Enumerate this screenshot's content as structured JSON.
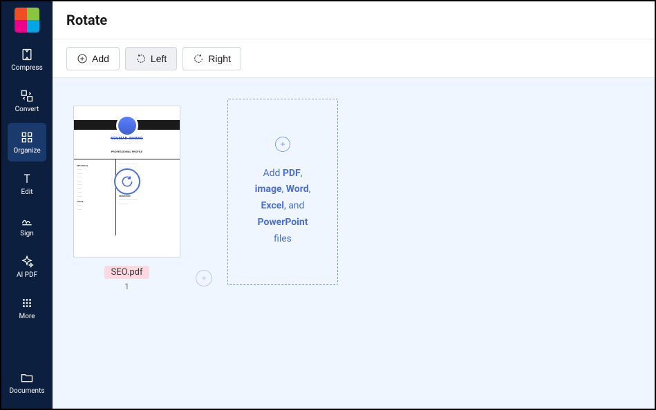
{
  "sidebar": {
    "items": [
      {
        "label": "Compress",
        "name": "compress"
      },
      {
        "label": "Convert",
        "name": "convert"
      },
      {
        "label": "Organize",
        "name": "organize",
        "active": true
      },
      {
        "label": "Edit",
        "name": "edit"
      },
      {
        "label": "Sign",
        "name": "sign"
      },
      {
        "label": "AI PDF",
        "name": "ai-pdf"
      },
      {
        "label": "More",
        "name": "more"
      },
      {
        "label": "Documents",
        "name": "documents"
      }
    ]
  },
  "header": {
    "title": "Rotate"
  },
  "toolbar": {
    "add_label": "Add",
    "left_label": "Left",
    "right_label": "Right"
  },
  "document": {
    "filename": "SEO.pdf",
    "page_number": "1",
    "preview": {
      "name": "NOUMAN AHMAD",
      "section1": "PROFESSIONAL PROFILE",
      "left_title1": "SEO SKILLS",
      "left_title2": "TOOLS",
      "right_title1": "EDUCATION"
    }
  },
  "dropzone": {
    "prefix": "Add ",
    "types": [
      "PDF",
      "image",
      "Word",
      "Excel",
      "PowerPoint"
    ],
    "and": ", and ",
    "suffix": " files"
  }
}
